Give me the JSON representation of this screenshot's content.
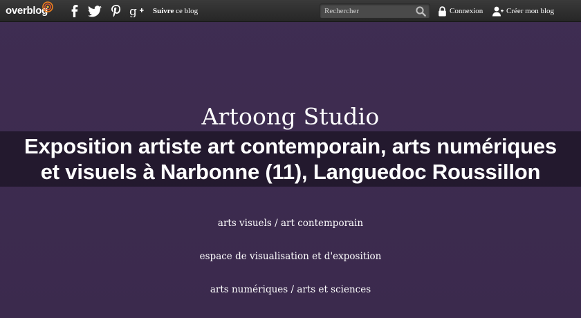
{
  "topbar": {
    "logo": {
      "part1": "over",
      "part2": "blog"
    },
    "social": [
      {
        "icon": "facebook-icon"
      },
      {
        "icon": "twitter-icon"
      },
      {
        "icon": "pinterest-icon"
      },
      {
        "icon": "google-plus-icon"
      }
    ],
    "follow": {
      "strong": "Suivre",
      "rest": " ce blog"
    },
    "search": {
      "placeholder": "Rechercher",
      "value": ""
    },
    "login_label": "Connexion",
    "create_blog_label": "Créer mon blog"
  },
  "main": {
    "site_title": "Artoong Studio",
    "headline_line1": "Exposition artiste art contemporain, arts numériques",
    "headline_line2": "et visuels à Narbonne (11), Languedoc Roussillon",
    "taglines": [
      "arts visuels / art contemporain",
      "espace de visualisation et d'exposition",
      "arts numériques / arts et sciences"
    ]
  },
  "colors": {
    "background": "#3d2c4f",
    "topbar": "#2e2e2e",
    "logo_accent": "#f0801e"
  }
}
